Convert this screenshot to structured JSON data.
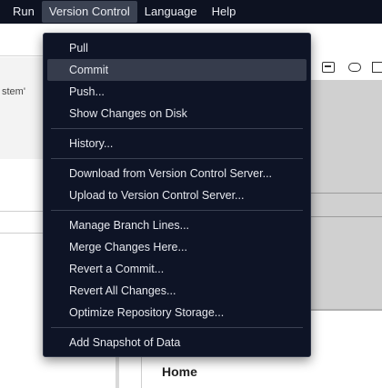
{
  "menubar": {
    "items": [
      {
        "label": "Run"
      },
      {
        "label": "Version Control"
      },
      {
        "label": "Language"
      },
      {
        "label": "Help"
      }
    ]
  },
  "background": {
    "snippet_text": "stem'",
    "home_title": "Home"
  },
  "dropdown": {
    "groups": [
      [
        "Pull",
        "Commit",
        "Push...",
        "Show Changes on Disk"
      ],
      [
        "History..."
      ],
      [
        "Download from Version Control Server...",
        "Upload to Version Control Server..."
      ],
      [
        "Manage Branch Lines...",
        "Merge Changes Here...",
        "Revert a Commit...",
        "Revert All Changes...",
        "Optimize Repository Storage..."
      ],
      [
        "Add Snapshot of Data"
      ]
    ],
    "highlighted": "Commit"
  },
  "colors": {
    "menubar_bg": "#0d1221",
    "dropdown_bg": "#0e1426",
    "highlight_bg": "#363c4c",
    "text": "#e6e8ee"
  }
}
